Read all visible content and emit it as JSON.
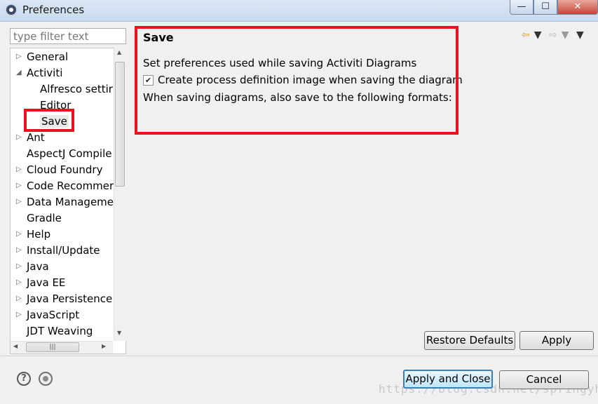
{
  "window": {
    "title": "Preferences",
    "minimize": "—",
    "maximize": "☐",
    "close": "✕"
  },
  "filter": {
    "placeholder": "type filter text"
  },
  "tree": [
    {
      "label": "General",
      "arrow": "▷"
    },
    {
      "label": "Activiti",
      "arrow": "◢"
    },
    {
      "label": "Alfresco settir",
      "arrow": ""
    },
    {
      "label": "Editor",
      "arrow": ""
    },
    {
      "label": "Save",
      "arrow": ""
    },
    {
      "label": "Ant",
      "arrow": "▷"
    },
    {
      "label": "AspectJ Compile",
      "arrow": ""
    },
    {
      "label": "Cloud Foundry",
      "arrow": "▷"
    },
    {
      "label": "Code Recommer",
      "arrow": "▷"
    },
    {
      "label": "Data Manageme",
      "arrow": "▷"
    },
    {
      "label": "Gradle",
      "arrow": ""
    },
    {
      "label": "Help",
      "arrow": "▷"
    },
    {
      "label": "Install/Update",
      "arrow": "▷"
    },
    {
      "label": "Java",
      "arrow": "▷"
    },
    {
      "label": "Java EE",
      "arrow": "▷"
    },
    {
      "label": "Java Persistence",
      "arrow": "▷"
    },
    {
      "label": "JavaScript",
      "arrow": "▷"
    },
    {
      "label": "JDT Weaving",
      "arrow": ""
    }
  ],
  "page": {
    "title": "Save",
    "description": "Set preferences used while saving Activiti Diagrams",
    "checkbox_label": "Create process definition image when saving the diagram",
    "checkbox_checked": true,
    "formats_label": "When saving diagrams, also save to the following formats:"
  },
  "nav": {
    "back": "⇦",
    "forward": "⇨",
    "menu": "▼"
  },
  "buttons": {
    "restore_defaults": "Restore Defaults",
    "apply": "Apply",
    "apply_and_close": "Apply and Close",
    "cancel": "Cancel"
  },
  "footer": {
    "help": "?"
  },
  "watermark": "https://blog.csdn.net/springyh",
  "colors": {
    "highlight": "#e8131e",
    "primary_border": "#3c7fb1"
  }
}
